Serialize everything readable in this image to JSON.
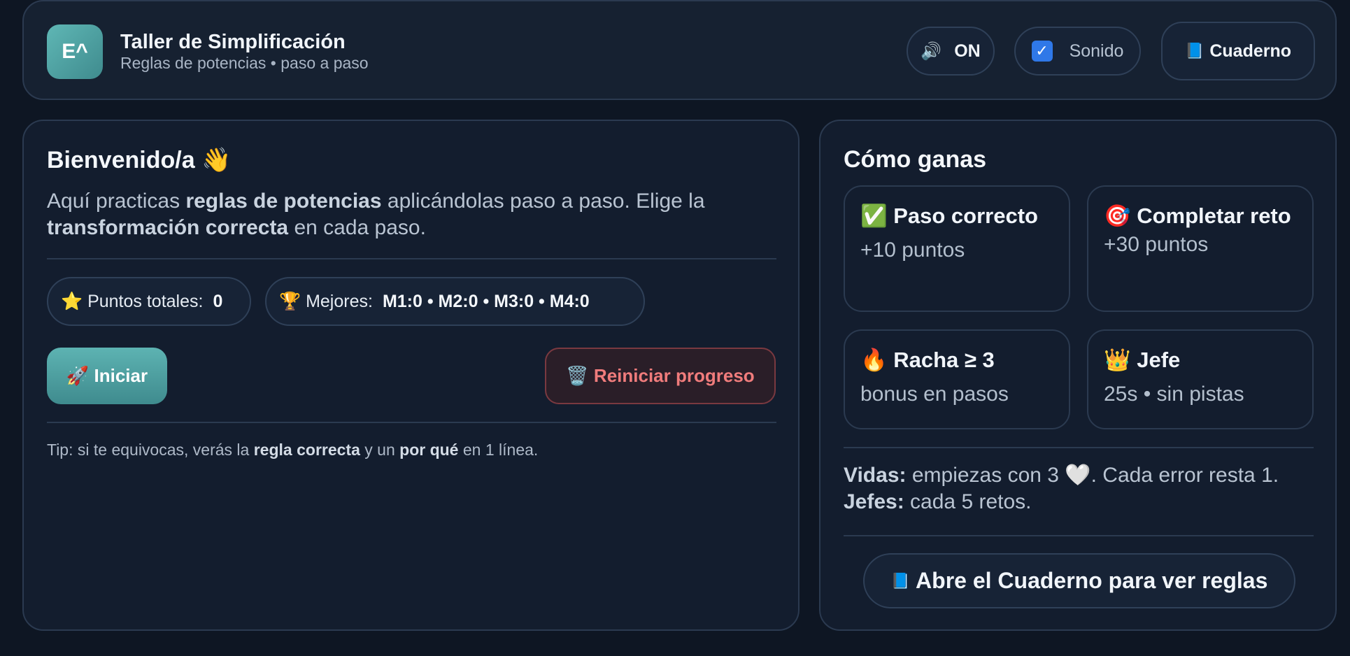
{
  "header": {
    "logo_text": "E^",
    "title": "Taller de Simplificación",
    "subtitle": "Reglas de potencias • paso a paso",
    "sound_on_label": "ON",
    "sound_toggle_label": "Sonido",
    "sound_checked": true,
    "notebook_label": "Cuaderno"
  },
  "welcome": {
    "heading": "Bienvenido/a 👋",
    "intro_1": "Aquí practicas ",
    "intro_b1": "reglas de potencias",
    "intro_2": " aplicándolas paso a paso. Elige la ",
    "intro_b2": "transformación correcta",
    "intro_3": " en cada paso.",
    "points_label": "⭐ Puntos totales:",
    "points_value": "0",
    "best_label": "🏆 Mejores:",
    "best_value": "M1:0 • M2:0 • M3:0 • M4:0",
    "start_label": "🚀 Iniciar",
    "reset_label": "🗑️ Reiniciar progreso",
    "tip_1": "Tip: si te equivocas, verás la ",
    "tip_b1": "regla correcta",
    "tip_2": " y un ",
    "tip_b2": "por qué",
    "tip_3": " en 1 línea."
  },
  "howto": {
    "heading": "Cómo ganas",
    "cards": [
      {
        "title": "✅ Paso correcto",
        "desc": "+10 puntos"
      },
      {
        "title": "🎯 Completar reto",
        "desc": "+30 puntos"
      },
      {
        "title": "🔥 Racha ≥ 3",
        "desc": "bonus en pasos"
      },
      {
        "title": "👑 Jefe",
        "desc": "25s • sin pistas"
      }
    ],
    "lives_label": "Vidas:",
    "lives_text": " empiezas con 3 🤍. Cada error resta 1.",
    "bosses_label": "Jefes:",
    "bosses_text": " cada 5 retos.",
    "open_notebook_label": "Abre el Cuaderno para ver reglas"
  }
}
